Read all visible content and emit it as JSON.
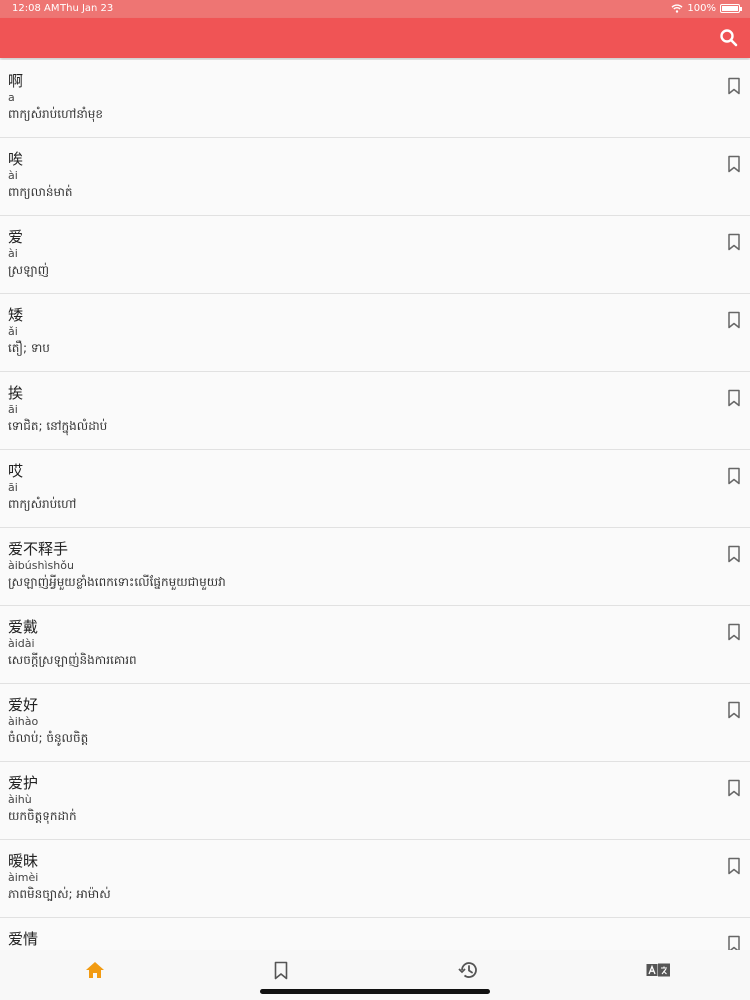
{
  "status": {
    "time": "12:08 AM",
    "date": "Thu Jan 23",
    "battery": "100%"
  },
  "colors": {
    "header": "#f05455",
    "status_bar": "#ee7573",
    "active_tab": "#f29b12"
  },
  "entries": [
    {
      "word": "啊",
      "pinyin": "a",
      "def": "ពាក្យសំរាប់ហៅនាំមុខ"
    },
    {
      "word": "唉",
      "pinyin": "ài",
      "def": "ពាក្យលាន់មាត់"
    },
    {
      "word": "爱",
      "pinyin": "ài",
      "def": "ស្រឡាញ់"
    },
    {
      "word": "矮",
      "pinyin": "ǎi",
      "def": "តឿ; ទាប"
    },
    {
      "word": "挨",
      "pinyin": "āi",
      "def": "ទោជិត; នៅក្នុងលំដាប់"
    },
    {
      "word": "哎",
      "pinyin": "āi",
      "def": "ពាក្យសំរាប់ហៅ"
    },
    {
      "word": "爱不释手",
      "pinyin": "àibúshìshǒu",
      "def": "ស្រឡាញ់អ្វីមួយខ្លាំងពេកទោះលើផ្នែកមួយជាមួយវា"
    },
    {
      "word": "爱戴",
      "pinyin": "àidài",
      "def": "សេចក្តីស្រឡាញ់និងការគោរព"
    },
    {
      "word": "爱好",
      "pinyin": "àihào",
      "def": "ចំលាប់; ចំនូលចិត្ត"
    },
    {
      "word": "爱护",
      "pinyin": "àihù",
      "def": "យកចិត្តទុកដាក់"
    },
    {
      "word": "暧昧",
      "pinyin": "àimèi",
      "def": "ភាពមិនច្បាស់; អាម៉ាស់"
    },
    {
      "word": "爱情",
      "pinyin": "",
      "def": ""
    }
  ],
  "tabs": [
    {
      "icon": "home-icon",
      "active": true
    },
    {
      "icon": "bookmark-icon",
      "active": false
    },
    {
      "icon": "history-icon",
      "active": false
    },
    {
      "icon": "translate-icon",
      "active": false
    }
  ]
}
